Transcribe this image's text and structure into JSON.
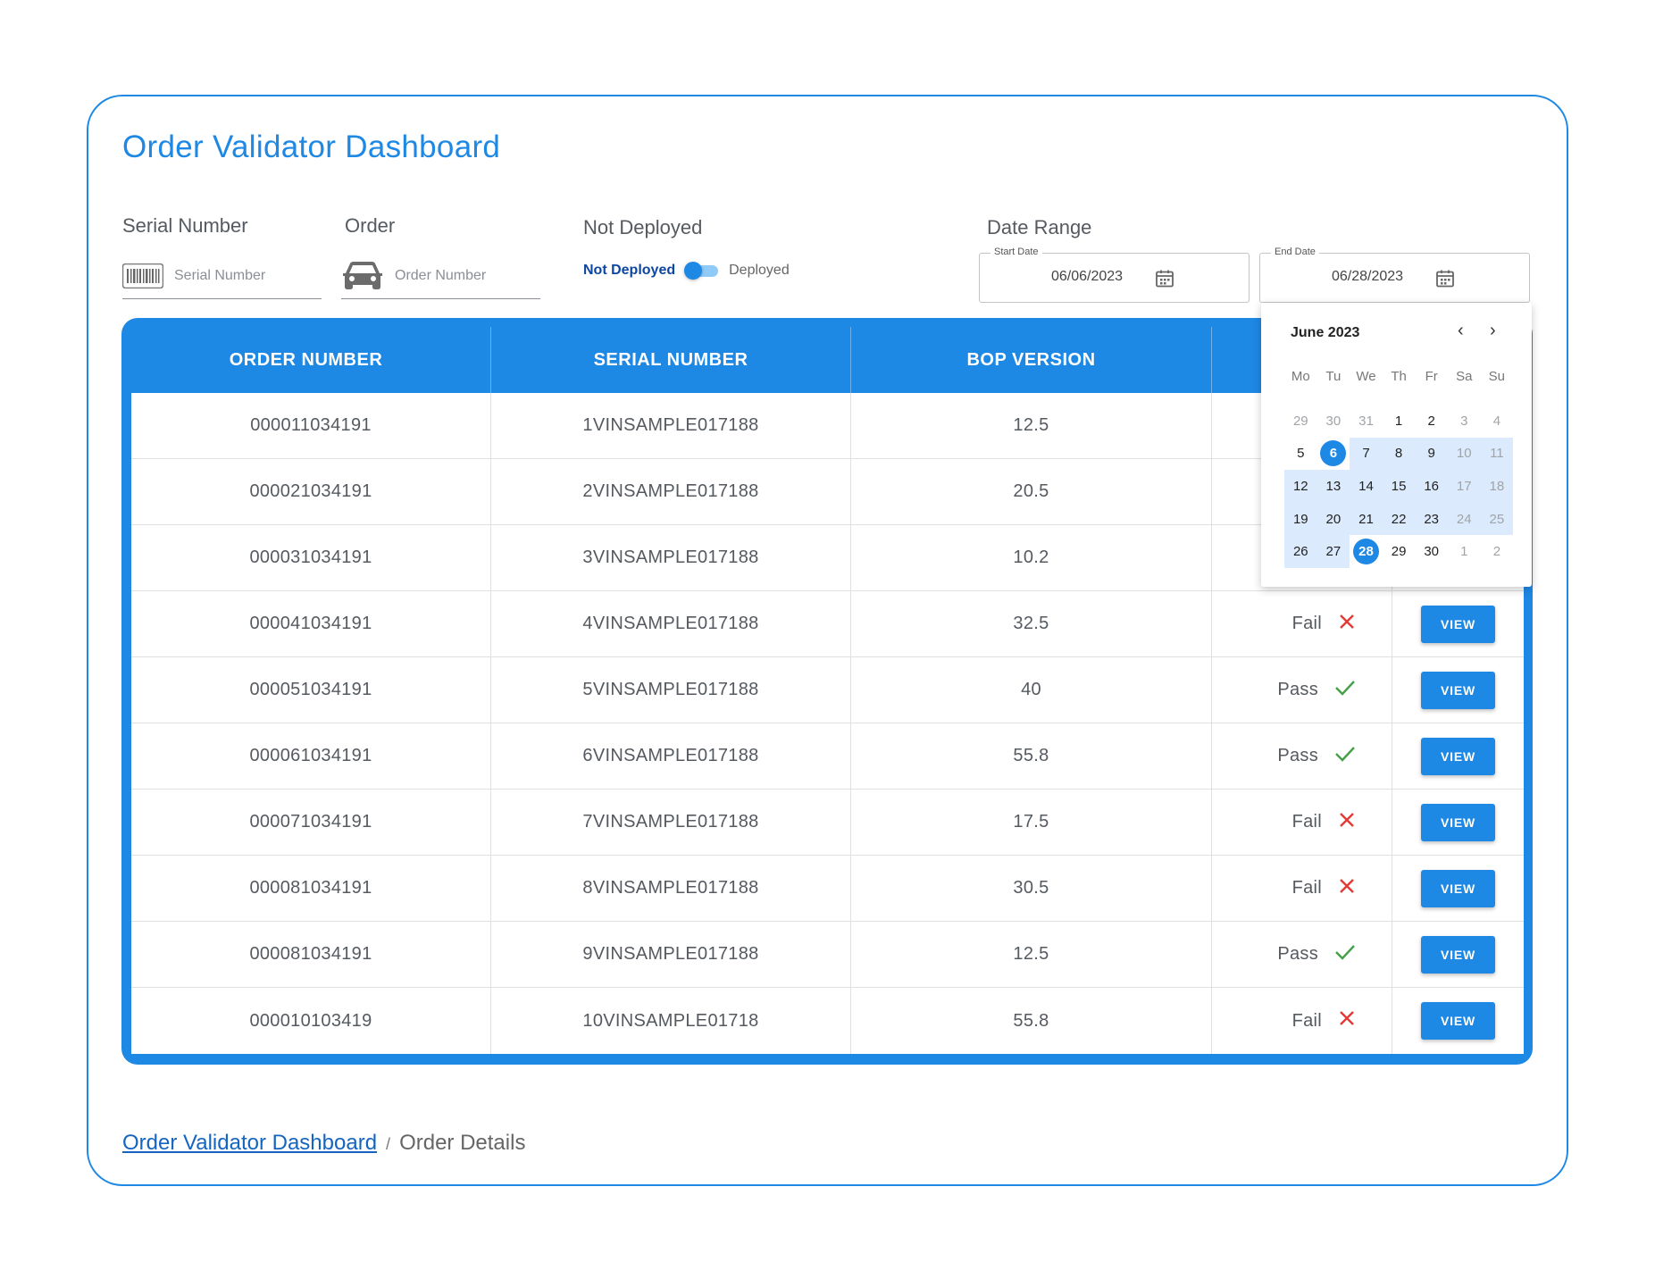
{
  "title": "Order Validator Dashboard",
  "filters": {
    "serial": {
      "label": "Serial Number",
      "placeholder": "Serial Number",
      "icon": "barcode-icon"
    },
    "order": {
      "label": "Order",
      "placeholder": "Order Number",
      "icon": "car-icon"
    },
    "deployed": {
      "label": "Not Deployed",
      "left": "Not Deployed",
      "right": "Deployed"
    },
    "date_range": {
      "label": "Date Range",
      "start": {
        "legend": "Start Date",
        "value": "06/06/2023"
      },
      "end": {
        "legend": "End Date",
        "value": "06/28/2023"
      }
    }
  },
  "table": {
    "columns": [
      "ORDER NUMBER",
      "SERIAL NUMBER",
      "BOP VERSION"
    ],
    "view_label": "VIEW",
    "rows": [
      {
        "order": "000011034191",
        "serial": "1VINSAMPLE017188",
        "bop": "12.5",
        "status": "",
        "pass": null
      },
      {
        "order": "000021034191",
        "serial": "2VINSAMPLE017188",
        "bop": "20.5",
        "status": "",
        "pass": null
      },
      {
        "order": "000031034191",
        "serial": "3VINSAMPLE017188",
        "bop": "10.2",
        "status": "",
        "pass": null
      },
      {
        "order": "000041034191",
        "serial": "4VINSAMPLE017188",
        "bop": "32.5",
        "status": "Fail",
        "pass": false
      },
      {
        "order": "000051034191",
        "serial": "5VINSAMPLE017188",
        "bop": "40",
        "status": "Pass",
        "pass": true
      },
      {
        "order": "000061034191",
        "serial": "6VINSAMPLE017188",
        "bop": "55.8",
        "status": "Pass",
        "pass": true
      },
      {
        "order": "000071034191",
        "serial": "7VINSAMPLE017188",
        "bop": "17.5",
        "status": "Fail",
        "pass": false
      },
      {
        "order": "000081034191",
        "serial": "8VINSAMPLE017188",
        "bop": "30.5",
        "status": "Fail",
        "pass": false
      },
      {
        "order": "000081034191",
        "serial": "9VINSAMPLE017188",
        "bop": "12.5",
        "status": "Pass",
        "pass": true
      },
      {
        "order": "000010103419",
        "serial": "10VINSAMPLE01718",
        "bop": "55.8",
        "status": "Fail",
        "pass": false
      }
    ]
  },
  "calendar": {
    "month": "June 2023",
    "weekdays": [
      "Mo",
      "Tu",
      "We",
      "Th",
      "Fr",
      "Sa",
      "Su"
    ],
    "days": [
      {
        "d": "29",
        "m": true
      },
      {
        "d": "30",
        "m": true
      },
      {
        "d": "31",
        "m": true
      },
      {
        "d": "1"
      },
      {
        "d": "2"
      },
      {
        "d": "3",
        "m": true
      },
      {
        "d": "4",
        "m": true
      },
      {
        "d": "5"
      },
      {
        "d": "6",
        "s": true
      },
      {
        "d": "7",
        "r": true
      },
      {
        "d": "8",
        "r": true
      },
      {
        "d": "9",
        "r": true
      },
      {
        "d": "10",
        "r": true,
        "m": true
      },
      {
        "d": "11",
        "r": true,
        "m": true
      },
      {
        "d": "12",
        "r": true
      },
      {
        "d": "13",
        "r": true
      },
      {
        "d": "14",
        "r": true
      },
      {
        "d": "15",
        "r": true
      },
      {
        "d": "16",
        "r": true
      },
      {
        "d": "17",
        "r": true,
        "m": true
      },
      {
        "d": "18",
        "r": true,
        "m": true
      },
      {
        "d": "19",
        "r": true
      },
      {
        "d": "20",
        "r": true
      },
      {
        "d": "21",
        "r": true
      },
      {
        "d": "22",
        "r": true
      },
      {
        "d": "23",
        "r": true
      },
      {
        "d": "24",
        "r": true,
        "m": true
      },
      {
        "d": "25",
        "r": true,
        "m": true
      },
      {
        "d": "26",
        "r": true
      },
      {
        "d": "27",
        "r": true
      },
      {
        "d": "28",
        "s": true
      },
      {
        "d": "29"
      },
      {
        "d": "30"
      },
      {
        "d": "1",
        "m": true
      },
      {
        "d": "2",
        "m": true
      }
    ]
  },
  "breadcrumb": {
    "link": "Order Validator Dashboard",
    "separator": "/",
    "current": "Order Details"
  },
  "colors": {
    "accent": "#1e88e5",
    "range": "#dbeafc",
    "pass": "#43a047",
    "fail": "#e53935"
  }
}
